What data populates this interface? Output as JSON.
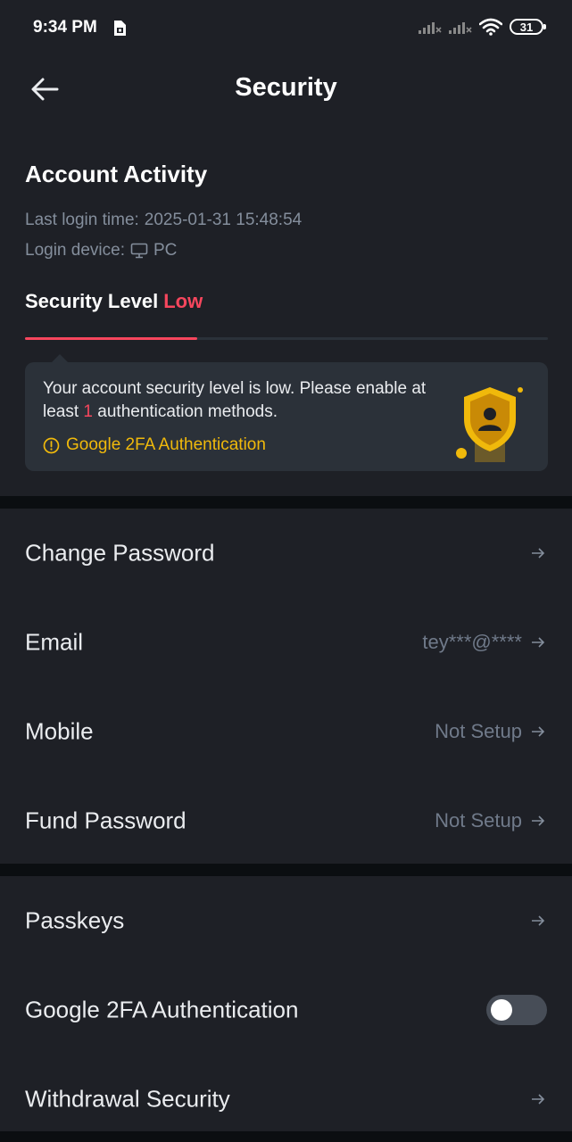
{
  "status_bar": {
    "time": "9:34 PM",
    "battery": "31"
  },
  "header": {
    "title": "Security"
  },
  "account_activity": {
    "title": "Account Activity",
    "last_login_label": "Last login time:",
    "last_login_value": "2025-01-31 15:48:54",
    "device_label": "Login device:",
    "device_value": "PC"
  },
  "security_level": {
    "label": "Security Level",
    "value": "Low",
    "progress_fraction": 0.33,
    "progress_color": "#f6465d"
  },
  "notice": {
    "text_before": "Your account security level is low. Please enable at least ",
    "count": "1",
    "text_after": " authentication methods.",
    "link_label": "Google 2FA Authentication"
  },
  "settings_group_1": [
    {
      "label": "Change Password",
      "value": ""
    },
    {
      "label": "Email",
      "value": "tey***@****"
    },
    {
      "label": "Mobile",
      "value": "Not Setup"
    },
    {
      "label": "Fund Password",
      "value": "Not Setup"
    }
  ],
  "settings_group_2": {
    "passkeys": {
      "label": "Passkeys"
    },
    "google_2fa": {
      "label": "Google 2FA Authentication",
      "enabled": false
    },
    "withdrawal": {
      "label": "Withdrawal Security"
    }
  },
  "colors": {
    "accent": "#f0b90b",
    "danger": "#f6465d",
    "background": "#1e2026"
  },
  "icons": [
    "sim-icon",
    "signal-icon",
    "wifi-icon",
    "battery-icon",
    "back-arrow-icon",
    "monitor-icon",
    "warning-circle-icon",
    "shield-user-icon",
    "arrow-right-icon"
  ]
}
